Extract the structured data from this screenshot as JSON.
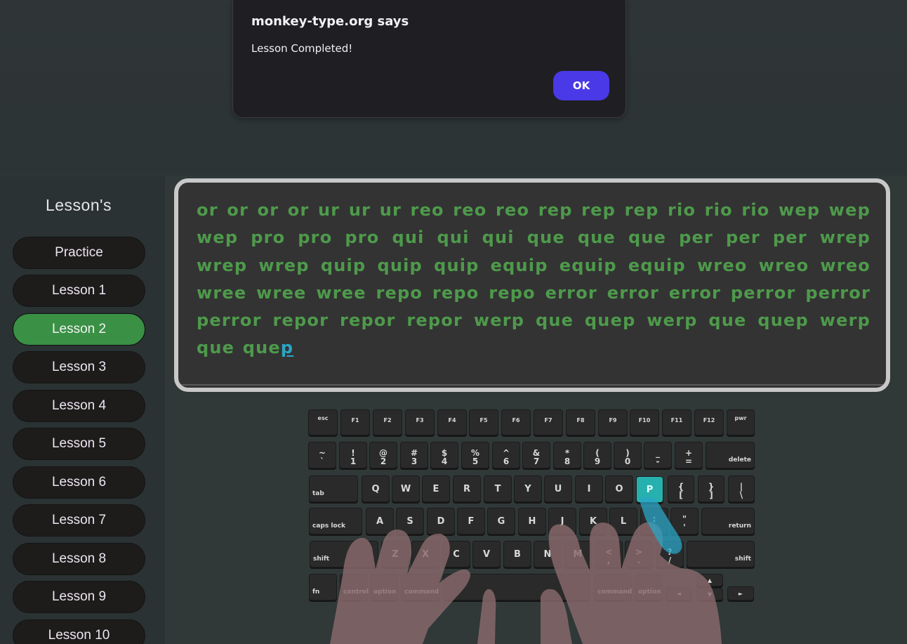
{
  "dialog": {
    "title": "monkey-type.org says",
    "message": "Lesson Completed!",
    "ok_label": "OK",
    "ok_color": "#4a39e6"
  },
  "sidebar": {
    "title": "Lesson's",
    "items": [
      {
        "label": "Practice",
        "active": false
      },
      {
        "label": "Lesson 1",
        "active": false
      },
      {
        "label": "Lesson 2",
        "active": true
      },
      {
        "label": "Lesson 3",
        "active": false
      },
      {
        "label": "Lesson 4",
        "active": false
      },
      {
        "label": "Lesson 5",
        "active": false
      },
      {
        "label": "Lesson 6",
        "active": false
      },
      {
        "label": "Lesson 7",
        "active": false
      },
      {
        "label": "Lesson 8",
        "active": false
      },
      {
        "label": "Lesson 9",
        "active": false
      },
      {
        "label": "Lesson 10",
        "active": false
      }
    ],
    "active_color": "#3a9044"
  },
  "typing": {
    "completed_text": "or or or or ur ur ur reo reo reo rep rep rep rio rio rio wep wep wep pro pro pro qui qui qui que que que per per per wrep wrep wrep quip quip quip equip equip equip wreo wreo wreo wree wree wree repo repo repo error error error perror perror perror repor repor repor werp que quep werp que quep werp que que",
    "current_char": "p",
    "completed_color": "#4e9a4b",
    "current_color": "#2aa5c6"
  },
  "keyboard": {
    "highlighted_key": "P",
    "highlight_color": "#27b1ae",
    "rows": {
      "function": [
        "esc",
        "F1",
        "F2",
        "F3",
        "F4",
        "F5",
        "F6",
        "F7",
        "F8",
        "F9",
        "F10",
        "F11",
        "F12",
        "pwr"
      ],
      "number": [
        {
          "top": "~",
          "bottom": "`"
        },
        {
          "top": "!",
          "bottom": "1"
        },
        {
          "top": "@",
          "bottom": "2"
        },
        {
          "top": "#",
          "bottom": "3"
        },
        {
          "top": "$",
          "bottom": "4"
        },
        {
          "top": "%",
          "bottom": "5"
        },
        {
          "top": "^",
          "bottom": "6"
        },
        {
          "top": "&",
          "bottom": "7"
        },
        {
          "top": "*",
          "bottom": "8"
        },
        {
          "top": "(",
          "bottom": "9"
        },
        {
          "top": ")",
          "bottom": "0"
        },
        {
          "top": "_",
          "bottom": "-"
        },
        {
          "top": "+",
          "bottom": "="
        }
      ],
      "number_end": "delete",
      "top_start": "tab",
      "top": [
        "Q",
        "W",
        "E",
        "R",
        "T",
        "Y",
        "U",
        "I",
        "O",
        "P"
      ],
      "top_brackets": [
        {
          "top": "{",
          "bottom": "["
        },
        {
          "top": "}",
          "bottom": "]"
        },
        {
          "top": "|",
          "bottom": "\\"
        }
      ],
      "home_start": "caps lock",
      "home": [
        "A",
        "S",
        "D",
        "F",
        "G",
        "H",
        "J",
        "K",
        "L"
      ],
      "home_punct": [
        {
          "top": ":",
          "bottom": ";"
        },
        {
          "top": "\"",
          "bottom": "'"
        }
      ],
      "home_end": "return",
      "shift_left": "shift",
      "bottom": [
        "Z",
        "X",
        "C",
        "V",
        "B",
        "N",
        "M"
      ],
      "bottom_punct": [
        {
          "top": "<",
          "bottom": ","
        },
        {
          "top": ">",
          "bottom": "."
        },
        {
          "top": "?",
          "bottom": "/"
        }
      ],
      "shift_right": "shift",
      "modifiers": [
        "fn",
        "control",
        "option",
        "command",
        "command",
        "option"
      ],
      "arrows": {
        "left": "◄",
        "up": "▲",
        "down": "▼",
        "right": "►"
      }
    }
  }
}
